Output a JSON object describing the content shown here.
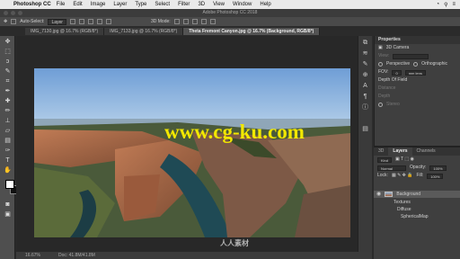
{
  "menubar": {
    "app_name": "Photoshop CC",
    "items": [
      "File",
      "Edit",
      "Image",
      "Layer",
      "Type",
      "Select",
      "Filter",
      "3D",
      "View",
      "Window",
      "Help"
    ]
  },
  "window": {
    "title": "Adobe Photoshop CC 2018"
  },
  "options": {
    "auto_select": "Auto-Select:",
    "auto_select_value": "Layer",
    "mode_label": "3D Mode:"
  },
  "tabs": [
    {
      "label": "IMG_7130.jpg @ 16.7% (RGB/8*)"
    },
    {
      "label": "IMG_7133.jpg @ 16.7% (RGB/8*)"
    },
    {
      "label": "Theta Fremont Canyon.jpg @ 16.7% (Background, RGB/8*)"
    }
  ],
  "watermark": {
    "text": "www.cg-ku.com",
    "logo_text": "人人素材"
  },
  "status": {
    "zoom": "16.67%",
    "doc": "Doc: 41.8M/41.8M"
  },
  "properties": {
    "title": "Properties",
    "subtitle": "3D Camera",
    "view_label": "View:",
    "perspective": "Perspective",
    "orthographic": "Orthographic",
    "fov_label": "FOV:",
    "fov_value": "0",
    "fov_unit": "mm lens",
    "dof_label": "Depth Of Field",
    "distance": "Distance",
    "depth": "Depth",
    "stereo": "Stereo"
  },
  "layers": {
    "tabs": [
      "3D",
      "Layers",
      "Channels"
    ],
    "kind": "Kind",
    "blend": "Normal",
    "opacity_label": "Opacity:",
    "opacity": "100%",
    "lock_label": "Lock:",
    "fill_label": "Fill:",
    "fill": "100%",
    "items": [
      {
        "name": "Background"
      },
      {
        "name": "Textures"
      },
      {
        "name": "Diffuse"
      },
      {
        "name": "SphericalMap"
      }
    ]
  }
}
